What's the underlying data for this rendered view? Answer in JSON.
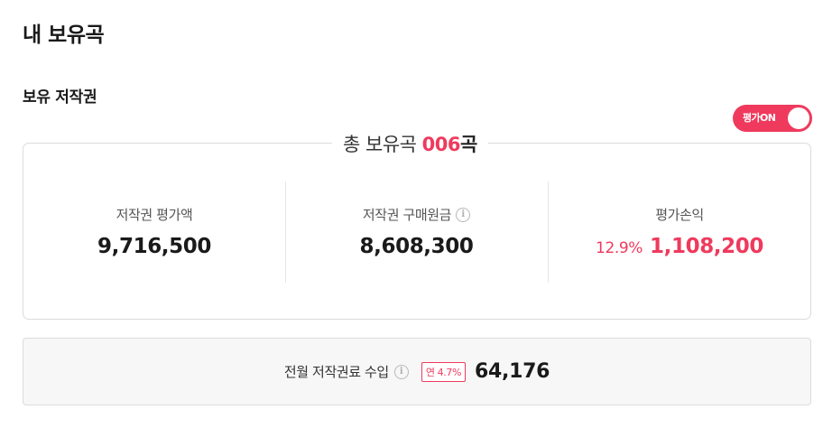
{
  "page_title": "내 보유곡",
  "section_title": "보유 저작권",
  "toggle": {
    "label": "평가ON",
    "on": true,
    "accent": "#ef3a5d"
  },
  "total": {
    "prefix": "총 보유곡",
    "count": "006",
    "unit": "곡"
  },
  "stats": [
    {
      "label": "저작권 평가액",
      "value": "9,716,500"
    },
    {
      "label": "저작권 구매원금",
      "value": "8,608,300",
      "icon": "info-icon"
    },
    {
      "label": "평가손익",
      "rate": "12.9%",
      "value": "1,108,200"
    }
  ],
  "income": {
    "label": "전월 저작권료 수입",
    "icon": "info-icon",
    "badge": "연 4.7%",
    "value": "64,176"
  }
}
